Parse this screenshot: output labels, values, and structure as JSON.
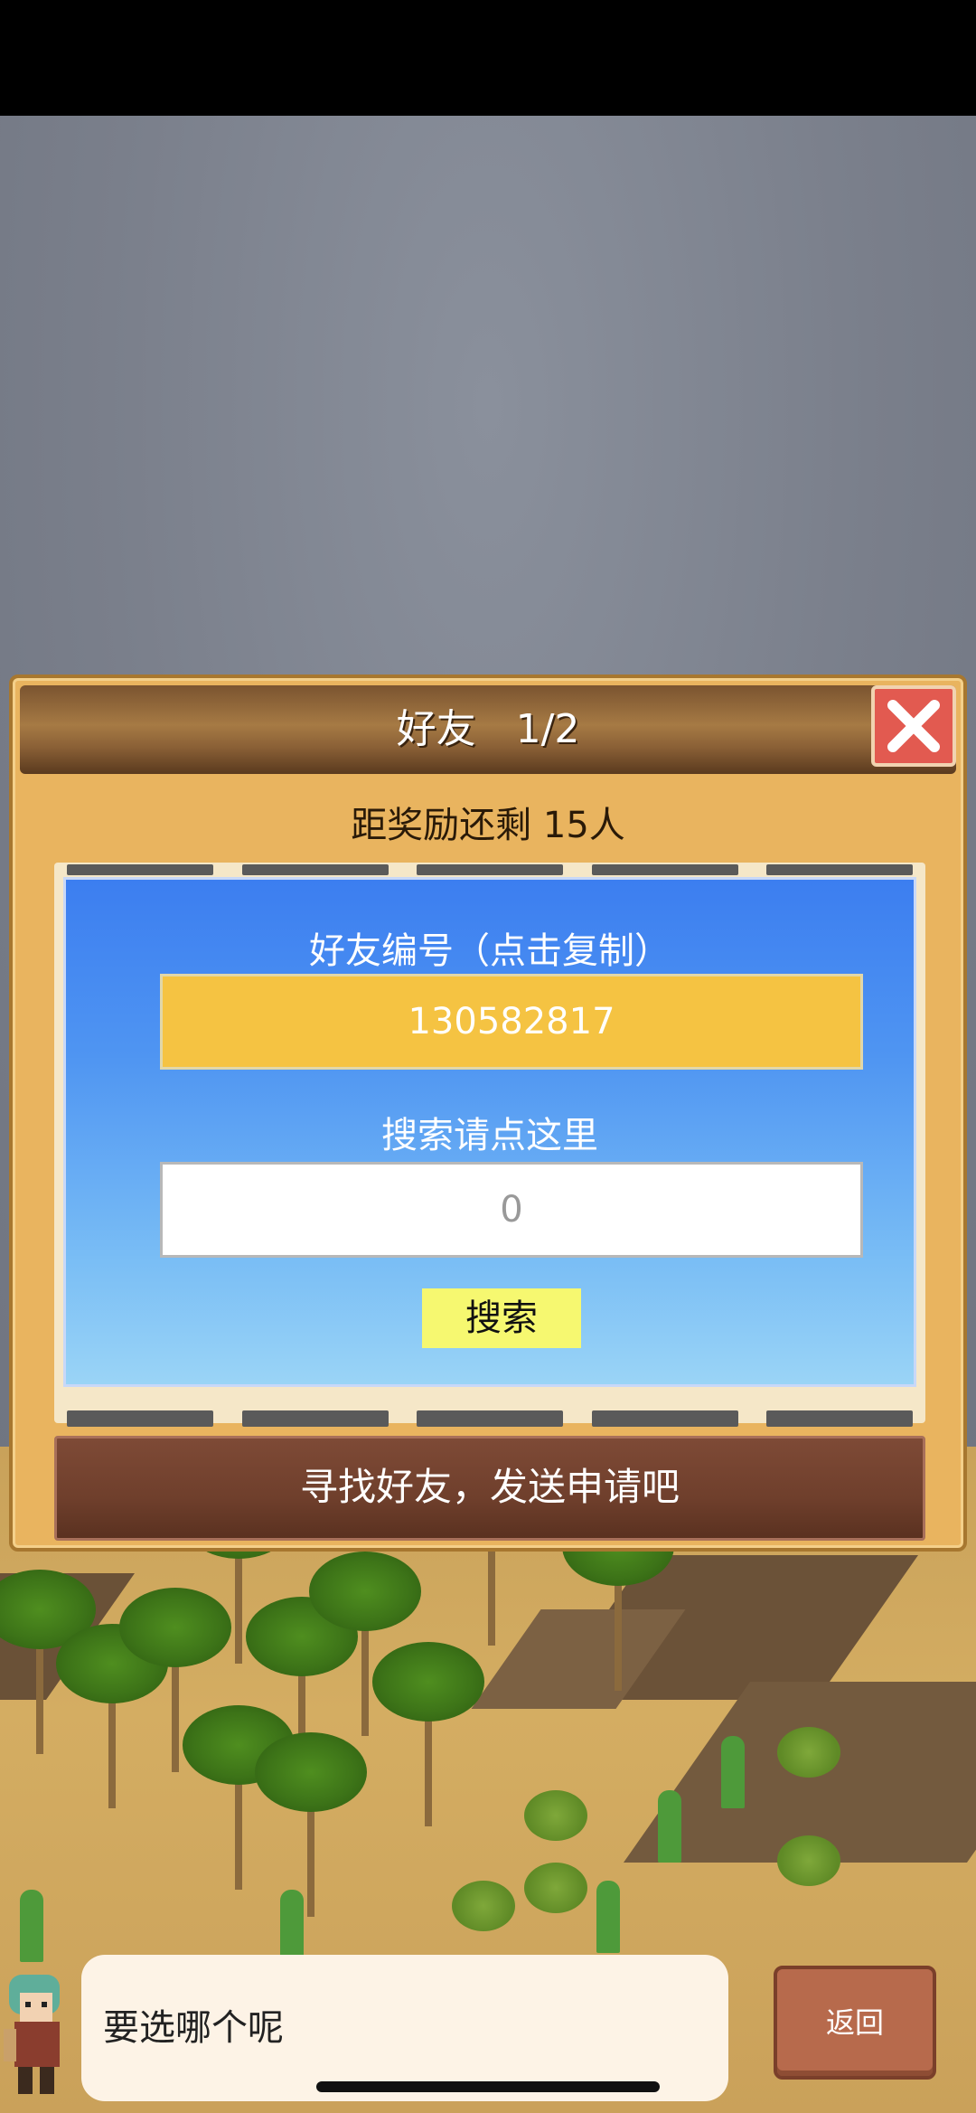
{
  "dialog": {
    "title": "好友　1/2",
    "reward_text": "距奖励还剩 15人",
    "friend_id_label": "好友编号（点击复制）",
    "friend_id": "130582817",
    "search_hint": "搜索请点这里",
    "search_input_value": "0",
    "search_button": "搜索",
    "request_text": "寻找好友，发送申请吧"
  },
  "bottom": {
    "speech": "要选哪个呢",
    "back_button": "返回"
  },
  "icons": {
    "close": "close-icon",
    "prev": "arrow-left-icon",
    "next": "arrow-right-icon"
  },
  "colors": {
    "close_button": "#e25a50",
    "friend_id_box": "#f5c342",
    "search_button": "#f6f870",
    "panel_top": "#3c7ef0"
  }
}
